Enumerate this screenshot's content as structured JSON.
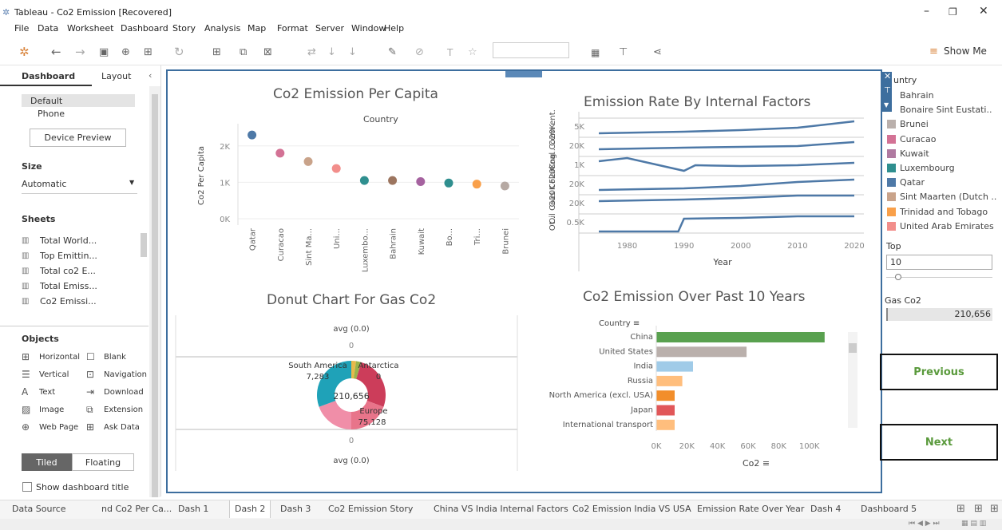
{
  "window": {
    "title": "Tableau - Co2 Emission [Recovered]",
    "min": "–",
    "restore": "❐",
    "close": "✕"
  },
  "menu": [
    "File",
    "Data",
    "Worksheet",
    "Dashboard",
    "Story",
    "Analysis",
    "Map",
    "Format",
    "Server",
    "Window",
    "Help"
  ],
  "toolbar": {
    "show_me": "Show Me"
  },
  "left_pane": {
    "tabs": [
      "Dashboard",
      "Layout"
    ],
    "devices": [
      "Default",
      "Phone"
    ],
    "device_preview": "Device Preview",
    "size_header": "Size",
    "size_value": "Automatic",
    "sheets_header": "Sheets",
    "sheets": [
      "Total World...",
      "Top Emittin...",
      "Total co2 E...",
      "Total Emiss...",
      "Co2 Emissi..."
    ],
    "objects_header": "Objects",
    "objects": [
      [
        "Horizontal",
        "Blank"
      ],
      [
        "Vertical",
        "Navigation"
      ],
      [
        "Text",
        "Download"
      ],
      [
        "Image",
        "Extension"
      ],
      [
        "Web Page",
        "Ask Data"
      ]
    ],
    "tiled": "Tiled",
    "floating": "Floating",
    "show_title": "Show dashboard title"
  },
  "charts": {
    "per_capita": {
      "title": "Co2 Emission Per Capita",
      "header": "Country",
      "ylabel": "Co2 Per Capita"
    },
    "internal": {
      "title": "Emission Rate By Internal Factors",
      "xlabel": "Year"
    },
    "donut": {
      "title": "Donut Chart For Gas Co2"
    },
    "past10": {
      "title": "Co2 Emission Over Past 10 Years",
      "header": "Country",
      "xlabel": "Co2"
    }
  },
  "chart_data": [
    {
      "type": "scatter",
      "title": "Co2 Emission Per Capita",
      "xlabel": "Country",
      "ylabel": "Co2 Per Capita",
      "ylim": [
        0,
        2500
      ],
      "yticks": [
        "0K",
        "1K",
        "2K"
      ],
      "categories": [
        "Qatar",
        "Curacao",
        "Sint Ma...",
        "Uni...",
        "Luxembo...",
        "Bahrain",
        "Kuwait",
        "Bo...",
        "Tri...",
        "Brunei"
      ],
      "values": [
        2300,
        1800,
        1570,
        1380,
        1050,
        1050,
        1020,
        980,
        950,
        900
      ],
      "colors": [
        "#4e79a7",
        "#d37295",
        "#c9a38a",
        "#f28e8b",
        "#2f8f8f",
        "#9c755f",
        "#a5629f",
        "#2f8f8f",
        "#f9a04a",
        "#b6a9a3"
      ]
    },
    {
      "type": "line",
      "title": "Emission Rate By Internal Factors",
      "xlabel": "Year",
      "x_ticks": [
        1980,
        1990,
        2000,
        2010,
        2020
      ],
      "row_labels": [
        "Cem ent.",
        "Coal Co20K",
        "Flari ng..",
        "Gas Co20K",
        "Oil Co20K",
        "Ot.."
      ],
      "tick_labels": [
        "5K",
        "20K",
        "1K",
        "20K",
        "20K",
        "0.5K"
      ]
    },
    {
      "type": "pie",
      "title": "Donut Chart For Gas Co2",
      "center": "210,656",
      "labels": [
        {
          "name": "South America",
          "value": "7,283"
        },
        {
          "name": "Antarctica",
          "value": "0"
        },
        {
          "name": "Europe",
          "value": "75,128"
        }
      ],
      "top_avg": "avg (0.0)",
      "top_zero": "0",
      "bot_zero": "0",
      "bot_avg": "avg (0.0)"
    },
    {
      "type": "bar",
      "title": "Co2 Emission Over Past 10 Years",
      "xlabel": "Co2",
      "ylabel": "Country",
      "categories": [
        "China",
        "United States",
        "India",
        "Russia",
        "North America (excl. USA)",
        "Japan",
        "International transport"
      ],
      "values": [
        110000,
        59000,
        24000,
        17000,
        12000,
        12000,
        12000
      ],
      "colors": [
        "#59a14f",
        "#bab0ac",
        "#a0cbe8",
        "#ffbe7d",
        "#f28e2b",
        "#e15759",
        "#ffbe7d"
      ],
      "x_ticks": [
        "0K",
        "20K",
        "40K",
        "60K",
        "80K",
        "100K"
      ],
      "xlim": [
        0,
        120000
      ]
    }
  ],
  "legend": {
    "title": "untry",
    "items": [
      {
        "name": "Bahrain",
        "color": ""
      },
      {
        "name": "Bonaire Sint Eustati..",
        "color": ""
      },
      {
        "name": "Brunei",
        "color": "#bab0ac"
      },
      {
        "name": "Curacao",
        "color": "#d37295"
      },
      {
        "name": "Kuwait",
        "color": "#b07aa1"
      },
      {
        "name": "Luxembourg",
        "color": "#2f8f8f"
      },
      {
        "name": "Qatar",
        "color": "#4e79a7"
      },
      {
        "name": "Sint Maarten (Dutch ..",
        "color": "#c9a38a"
      },
      {
        "name": "Trinidad and Tobago",
        "color": "#f9a04a"
      },
      {
        "name": "United Arab Emirates",
        "color": "#f28e8b"
      }
    ]
  },
  "top": {
    "label": "Top",
    "value": "10"
  },
  "gas_filter": {
    "label": "Gas Co2",
    "value": "210,656"
  },
  "nav": {
    "previous": "Previous",
    "next": "Next"
  },
  "tabs": [
    "Data Source",
    "nd Co2 Per Ca...",
    "Dash 1",
    "Dash 2",
    "Dash 3",
    "Co2 Emission Story",
    "China VS India Internal Factors",
    "Co2 Emission India VS USA",
    "Emission Rate Over Year",
    "Dash 4",
    "Dashboard 5"
  ]
}
